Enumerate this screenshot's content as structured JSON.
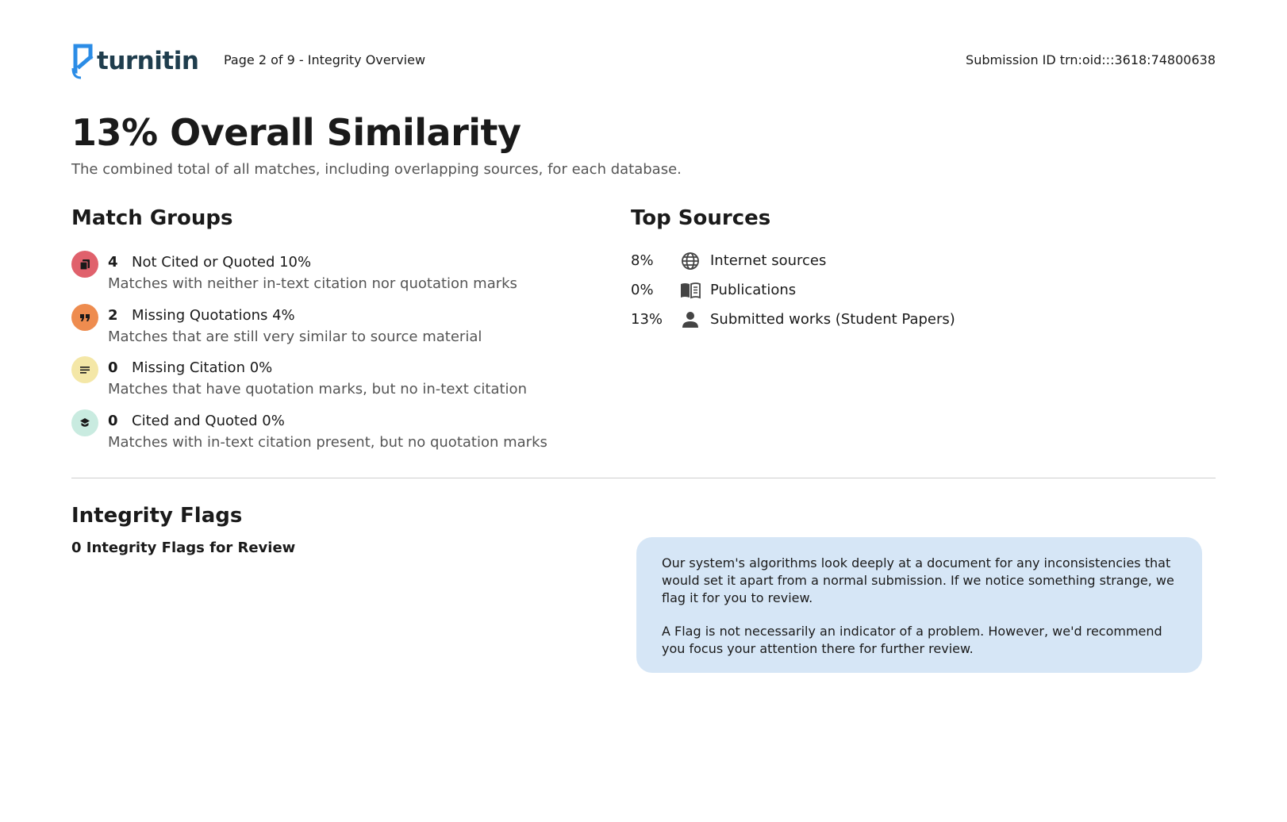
{
  "header": {
    "logo_text": "turnitin",
    "page_label": "Page 2 of 9 - Integrity Overview",
    "submission_id": "Submission ID trn:oid:::3618:74800638"
  },
  "summary": {
    "title": "13% Overall Similarity",
    "subtitle": "The combined total of all matches, including overlapping sources, for each database."
  },
  "match_groups": {
    "heading": "Match Groups",
    "items": [
      {
        "count": "4",
        "label": "Not Cited or Quoted 10%",
        "description": "Matches with neither in-text citation nor quotation marks",
        "color": "#e0616c",
        "icon": "document-copy-icon"
      },
      {
        "count": "2",
        "label": "Missing Quotations 4%",
        "description": "Matches that are still very similar to source material",
        "color": "#ee8c4f",
        "icon": "quote-icon"
      },
      {
        "count": "0",
        "label": "Missing Citation 0%",
        "description": "Matches that have quotation marks, but no in-text citation",
        "color": "#f4e7a7",
        "icon": "lines-icon"
      },
      {
        "count": "0",
        "label": "Cited and Quoted 0%",
        "description": "Matches with in-text citation present, but no quotation marks",
        "color": "#c9ebe0",
        "icon": "cited-icon"
      }
    ]
  },
  "top_sources": {
    "heading": "Top Sources",
    "items": [
      {
        "percent": "8%",
        "label": "Internet sources",
        "icon": "globe-icon"
      },
      {
        "percent": "0%",
        "label": "Publications",
        "icon": "book-icon"
      },
      {
        "percent": "13%",
        "label": "Submitted works (Student Papers)",
        "icon": "person-icon"
      }
    ]
  },
  "integrity_flags": {
    "heading": "Integrity Flags",
    "subheading": "0 Integrity Flags for Review",
    "info_paragraph_1": "Our system's algorithms look deeply at a document for any inconsistencies that would set it apart from a normal submission. If we notice something strange, we flag it for you to review.",
    "info_paragraph_2": "A Flag is not necessarily an indicator of a problem. However, we'd recommend you focus your attention there for further review.",
    "info_box_color": "#d6e6f6"
  }
}
